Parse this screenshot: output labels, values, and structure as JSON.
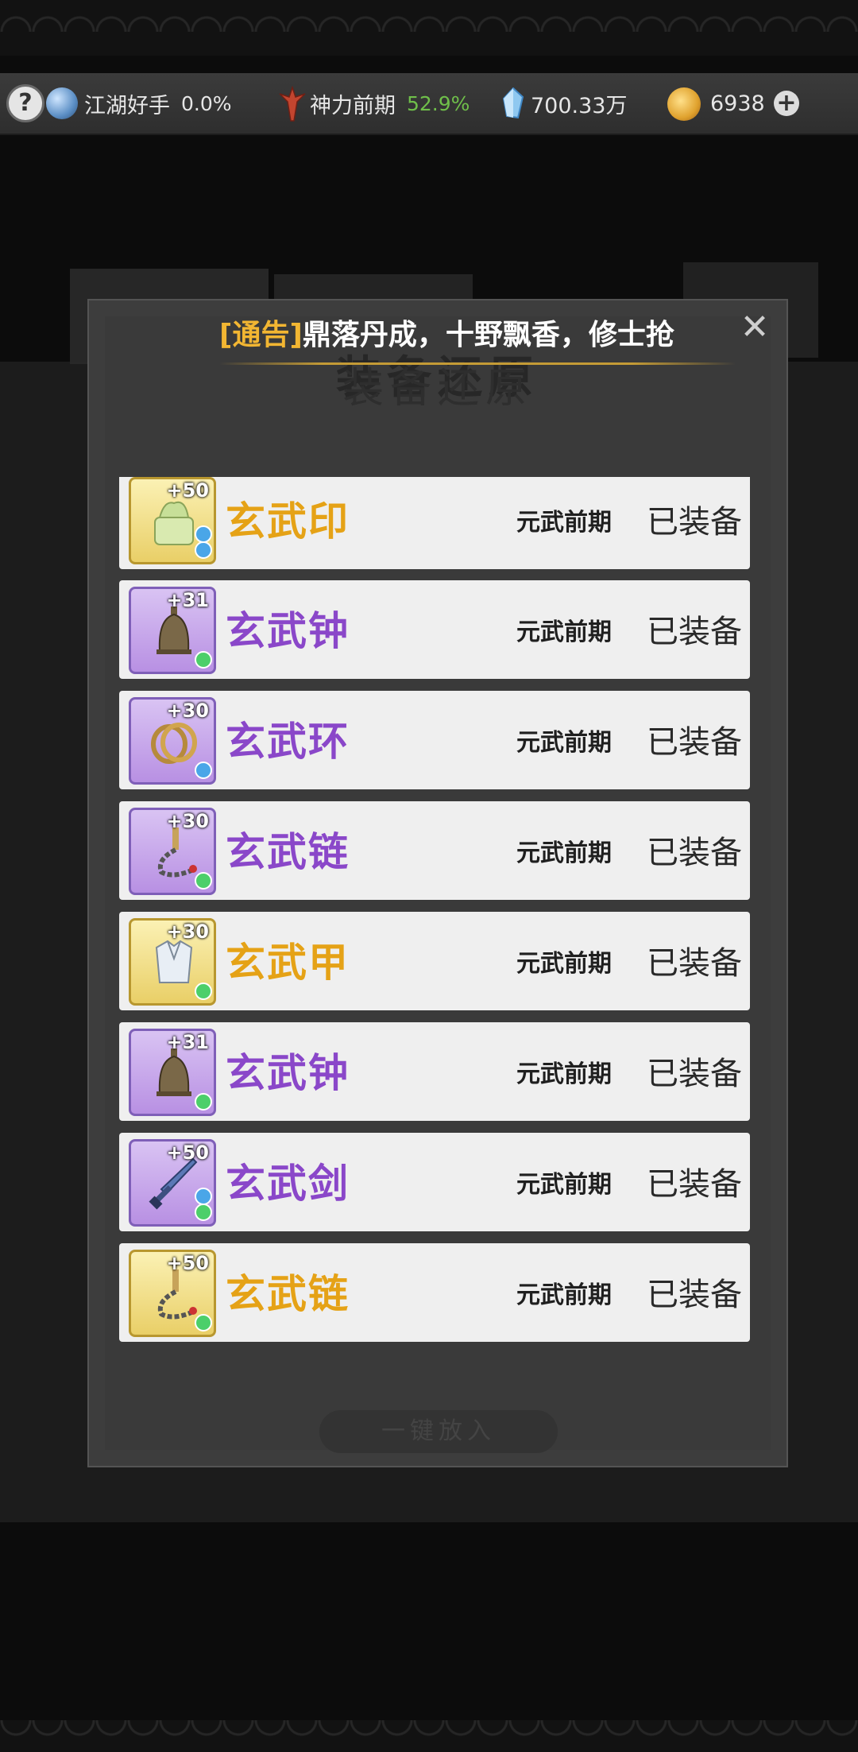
{
  "topbar": {
    "help_label": "?",
    "rank_title": "江湖好手",
    "rank_progress": "0.0%",
    "power_title": "神力前期",
    "power_progress": "52.9%",
    "crystal_amount": "700.33万",
    "gold_amount": "6938",
    "plus_label": "+"
  },
  "notice": {
    "tag": "[通告]",
    "text": "鼎落丹成，十野飘香，修士抢"
  },
  "modal": {
    "title": "装备还原",
    "close_label": "✕",
    "bottom_button": "一键放入"
  },
  "items": [
    {
      "name": "玄武印",
      "level": "+50",
      "realm": "元武前期",
      "status": "已装备",
      "quality": "gold",
      "badges": [
        "blue",
        "blue"
      ],
      "art": "seal-icon"
    },
    {
      "name": "玄武钟",
      "level": "+31",
      "realm": "元武前期",
      "status": "已装备",
      "quality": "purple",
      "badges": [
        "green"
      ],
      "art": "bell-icon"
    },
    {
      "name": "玄武环",
      "level": "+30",
      "realm": "元武前期",
      "status": "已装备",
      "quality": "purple",
      "badges": [
        "blue"
      ],
      "art": "ring-icon"
    },
    {
      "name": "玄武链",
      "level": "+30",
      "realm": "元武前期",
      "status": "已装备",
      "quality": "purple",
      "badges": [
        "green"
      ],
      "art": "chain-icon"
    },
    {
      "name": "玄武甲",
      "level": "+30",
      "realm": "元武前期",
      "status": "已装备",
      "quality": "gold",
      "badges": [
        "green"
      ],
      "art": "armor-icon"
    },
    {
      "name": "玄武钟",
      "level": "+31",
      "realm": "元武前期",
      "status": "已装备",
      "quality": "purple",
      "badges": [
        "green"
      ],
      "art": "bell-icon"
    },
    {
      "name": "玄武剑",
      "level": "+50",
      "realm": "元武前期",
      "status": "已装备",
      "quality": "purple",
      "badges": [
        "blue",
        "green"
      ],
      "art": "sword-icon"
    },
    {
      "name": "玄武链",
      "level": "+50",
      "realm": "元武前期",
      "status": "已装备",
      "quality": "gold",
      "badges": [
        "green"
      ],
      "art": "chain-icon"
    }
  ]
}
